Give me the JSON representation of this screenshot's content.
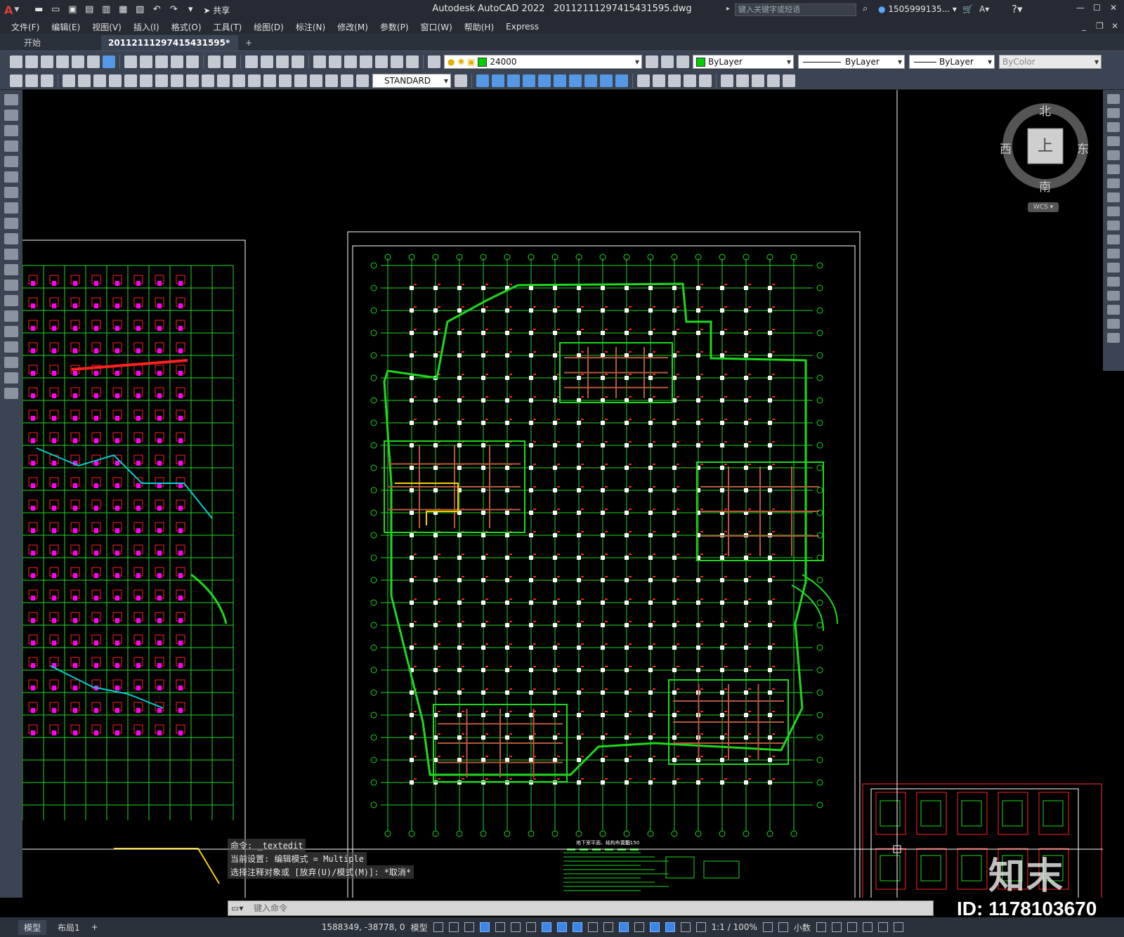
{
  "title": {
    "app": "Autodesk AutoCAD 2022",
    "file": "20112111297415431595.dwg",
    "share_label": "共享",
    "search_placeholder": "键入关键字或短语",
    "user": "1505999135..."
  },
  "menu": [
    "文件(F)",
    "编辑(E)",
    "视图(V)",
    "插入(I)",
    "格式(O)",
    "工具(T)",
    "绘图(D)",
    "标注(N)",
    "修改(M)",
    "参数(P)",
    "窗口(W)",
    "帮助(H)",
    "Express"
  ],
  "tabs": {
    "start": "开始",
    "active": "20112111297415431595*",
    "close": "×",
    "add": "+"
  },
  "toolbar": {
    "layer_value": "24000",
    "color_value": "ByLayer",
    "linetype_value": "ByLayer",
    "lineweight_value": "ByLayer",
    "plotstyle_value": "ByColor",
    "textstyle_value": "STANDARD"
  },
  "viewcube": {
    "north": "北",
    "south": "南",
    "east": "东",
    "west": "西",
    "top": "上",
    "wcs": "WCS"
  },
  "command": {
    "history": [
      "命令: _textedit",
      "当前设置: 编辑模式 = Multiple",
      "选择注释对象或 [放弃(U)/模式(M)]: *取消*"
    ],
    "placeholder": "键入命令"
  },
  "drawing_texts": {
    "plan_title": "地下室平面、结构布置图",
    "plan_scale": "1:150"
  },
  "status": {
    "layout_model": "模型",
    "layout_1": "布局1",
    "add": "+",
    "coords": "1588349, -38778, 0",
    "space": "模型",
    "scale": "1:1 / 100%",
    "units": "小数"
  },
  "overlay": {
    "brand": "知末",
    "id": "ID: 1178103670"
  },
  "colors": {
    "grid_green": "#1fd81f",
    "column_red": "#ff2020",
    "magenta": "#ff00ff",
    "cyan": "#00d0d0",
    "white": "#ffffff",
    "brown": "#b55a3c",
    "yellow": "#f5d300"
  }
}
